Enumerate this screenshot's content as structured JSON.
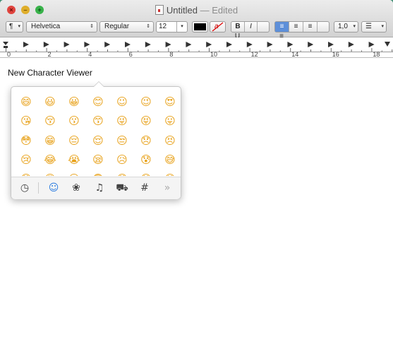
{
  "window": {
    "title": "Untitled",
    "edited": "— Edited"
  },
  "toolbar": {
    "paragraph_btn": "¶",
    "font_family": "Helvetica",
    "font_style": "Regular",
    "font_size": "12",
    "bold": "B",
    "italic": "I",
    "underline": "U",
    "line_spacing": "1,0",
    "list_icon": "list-icon",
    "text_color": "#000000",
    "highlight_icon": "a"
  },
  "ruler": {
    "labels": [
      "0",
      "2",
      "4",
      "6",
      "8",
      "10",
      "12",
      "14",
      "16",
      "18"
    ]
  },
  "document": {
    "text": "New Character Viewer"
  },
  "character_viewer": {
    "emoji_rows": [
      [
        "😄",
        "😃",
        "😀",
        "😊",
        "☺",
        "😉",
        "😍"
      ],
      [
        "😘",
        "😚",
        "😗",
        "😙",
        "😜",
        "😝",
        "😛"
      ],
      [
        "😳",
        "😁",
        "😔",
        "😌",
        "😒",
        "😞",
        "😣"
      ],
      [
        "😢",
        "😂",
        "😭",
        "😪",
        "😥",
        "😰",
        "😅"
      ],
      [
        "😓",
        "😩",
        "😫",
        "😨",
        "😱",
        "😠",
        "😡"
      ]
    ],
    "categories": [
      {
        "icon": "recent-clock-icon",
        "glyph": "◷"
      },
      {
        "icon": "smiley-icon",
        "glyph": "☺"
      },
      {
        "icon": "flower-icon",
        "glyph": "❀"
      },
      {
        "icon": "bell-icon",
        "glyph": "♫"
      },
      {
        "icon": "car-icon",
        "glyph": "⛟"
      },
      {
        "icon": "symbols-icon",
        "glyph": "#"
      },
      {
        "icon": "more-chevron-icon",
        "glyph": "»"
      }
    ]
  }
}
